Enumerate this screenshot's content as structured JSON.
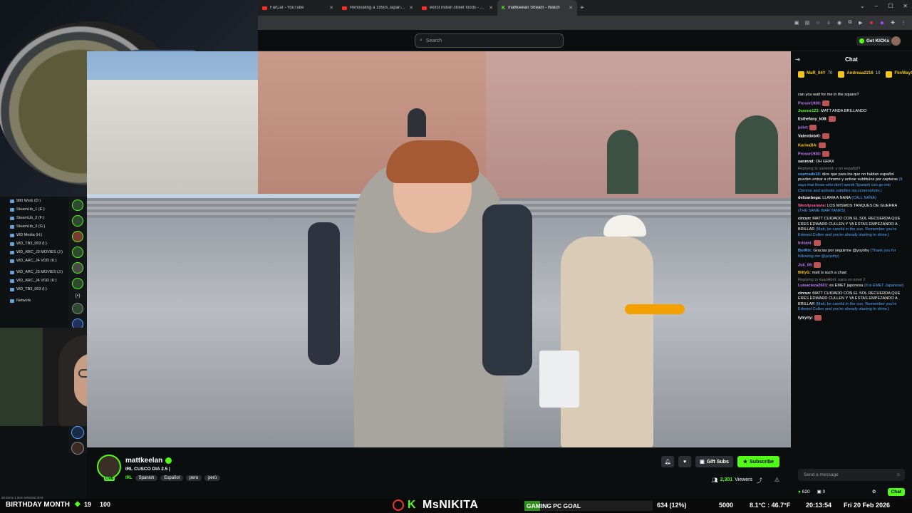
{
  "browser": {
    "tabs": [
      {
        "label": "FarCar - YouTube",
        "favicon": "youtube-icon"
      },
      {
        "label": "Renovating a 1950s Japanese H",
        "favicon": "youtube-icon"
      },
      {
        "label": "worst indian street foods - YouT",
        "favicon": "youtube-icon"
      },
      {
        "label": "mattkeelan Stream - Watch",
        "favicon": "kick-icon",
        "active": true
      }
    ],
    "new_tab": "+"
  },
  "header": {
    "search_placeholder": "Search",
    "get_kicks": "Get KICKs"
  },
  "desktop": {
    "drives": [
      "980 Work (D:)",
      "SteamLib_1 (E:)",
      "SteamLib_2 (F:)",
      "SteamLib_3 (G:)",
      "WD Media (H:)",
      "WD_TB3_003 (I:)",
      "WD_ARC_J3 MOVIES (J:)",
      "WD_ARC_J4 VOD (K:)",
      "WD_ARC_J3 MOVIES (J:)",
      "WD_ARC_J4 VOD (K:)",
      "WD_TB3_003 (I:)",
      "Network"
    ],
    "status": "30 items  1 item selected  30.5"
  },
  "chat": {
    "title": "Chat",
    "pinned": [
      {
        "user": "MaR_04Y",
        "count": "70"
      },
      {
        "user": "Andreaa2216",
        "count": "10"
      },
      {
        "user": "FknWayShe0...",
        "count": "5"
      }
    ],
    "messages": [
      {
        "user": "",
        "text": "can you wait for me in the square?",
        "translation": "",
        "color": "#4fa8ff"
      },
      {
        "user": "Prosor1930:",
        "text": "",
        "translation": "",
        "color": "#c77dff"
      },
      {
        "user": "Jeanne123:",
        "text": "MATT ANDA BRILLANDO",
        "translation": "",
        "color": "#53fc18"
      },
      {
        "user": "Esthefany_k08:",
        "text": "",
        "translation": "",
        "color": "#ffffff"
      },
      {
        "user": "julivt:",
        "text": "",
        "translation": "",
        "color": "#c77dff"
      },
      {
        "user": "Valentinbr0:",
        "text": "",
        "translation": "",
        "color": "#ffffff"
      },
      {
        "user": "KarinaBA:",
        "text": "",
        "translation": "",
        "color": "#f5c518"
      },
      {
        "user": "Prosor1930:",
        "text": "",
        "translation": "",
        "color": "#c77dff"
      },
      {
        "user": "sanmnd:",
        "text": "OH GRAX",
        "translation": "",
        "color": "#ffffff"
      },
      {
        "reply": "Replying to sanmnd: y en español?",
        "user": "cearcade10:",
        "text": "dice que para los que no hablan español pueden entrar a chrome y activar subtitulos por capturas",
        "translation": "(It says that those who don't speak Spanish can go into Chrome and activate subtitles via screenshots.)",
        "color": "#4fa8ff"
      },
      {
        "user": "delizarbega:",
        "text": "LLAMA A NANA",
        "translation": "(CALL NANA)",
        "color": "#ffffff"
      },
      {
        "user": "Wendysaravia:",
        "text": "LOS MISMOS TANQUES DE GUERRA",
        "translation": "(THE SAME WAR TANKS)",
        "color": "#ff5fa2"
      },
      {
        "user": "circun:",
        "text": "MATT CUIDADO CON EL SOL RECUERDA QUE ERES EDWARD CULLEN Y YA ESTAS EMPEZANDO A BRILLAR",
        "translation": "(Matt, be careful in the sun. Remember you're Edward Cullen and you're already starting to shine.)",
        "color": "#ffffff"
      },
      {
        "user": "brisani:",
        "text": "",
        "translation": "",
        "color": "#c77dff"
      },
      {
        "user": "BotRix:",
        "text": "Gracias por seguirme @yoyohy",
        "translation": "(Thank you for following me @yoyohy)",
        "color": "#4fa8ff"
      },
      {
        "user": "Juli_09:",
        "text": "",
        "translation": "",
        "color": "#c77dff"
      },
      {
        "user": "BillyG:",
        "text": "matt is such a chad",
        "translation": "",
        "color": "#f5c518"
      },
      {
        "reply": "Replying to kaariAbril: nana es emet 2",
        "user": "Luisacieza2601:",
        "text": "es EMET japonesa",
        "translation": "(It is EMET Japanese)",
        "color": "#c77dff"
      },
      {
        "user": "circun:",
        "text": "MATT CUIDADO CON EL SOL RECUERDA QUE ERES EDWARD CULLEN Y YA ESTAS EMPEZANDO A BRILLAR",
        "translation": "(Matt, be careful in the sun. Remember you're Edward Cullen and you're already starting to shine.)",
        "color": "#ffffff"
      },
      {
        "user": "tytryrty:",
        "text": "",
        "translation": "",
        "color": "#ffffff"
      }
    ],
    "input_placeholder": "Send a message",
    "kicks": "620",
    "gifts": "0",
    "chat_button": "Chat"
  },
  "channel": {
    "name": "mattkeelan",
    "live_badge": "LIVE",
    "title": "IRL CUSCO DIA 2.5 |",
    "category": "IRL",
    "tags": [
      "Spanish",
      "Español",
      "peru",
      "perú"
    ],
    "gift_subs": "Gift Subs",
    "subscribe": "Subscribe",
    "viewers_count": "2,301",
    "viewers_label": "Viewers"
  },
  "overlay": {
    "birthday": "BIRTHDAY MONTH",
    "birthday_count": "19",
    "birthday_pct": "100",
    "brand": "MsNIKITA",
    "goal_label": "GAMING PC GOAL",
    "goal_progress": 0.12,
    "goal_value": "634 (12%)",
    "goal_target": "5000",
    "weather": "8.1°C : 46.7°F",
    "clock": "20:13:54",
    "date": "Fri 20 Feb 2026"
  },
  "colors": {
    "kick_green": "#53fc18",
    "background": "#0b0e0f"
  }
}
